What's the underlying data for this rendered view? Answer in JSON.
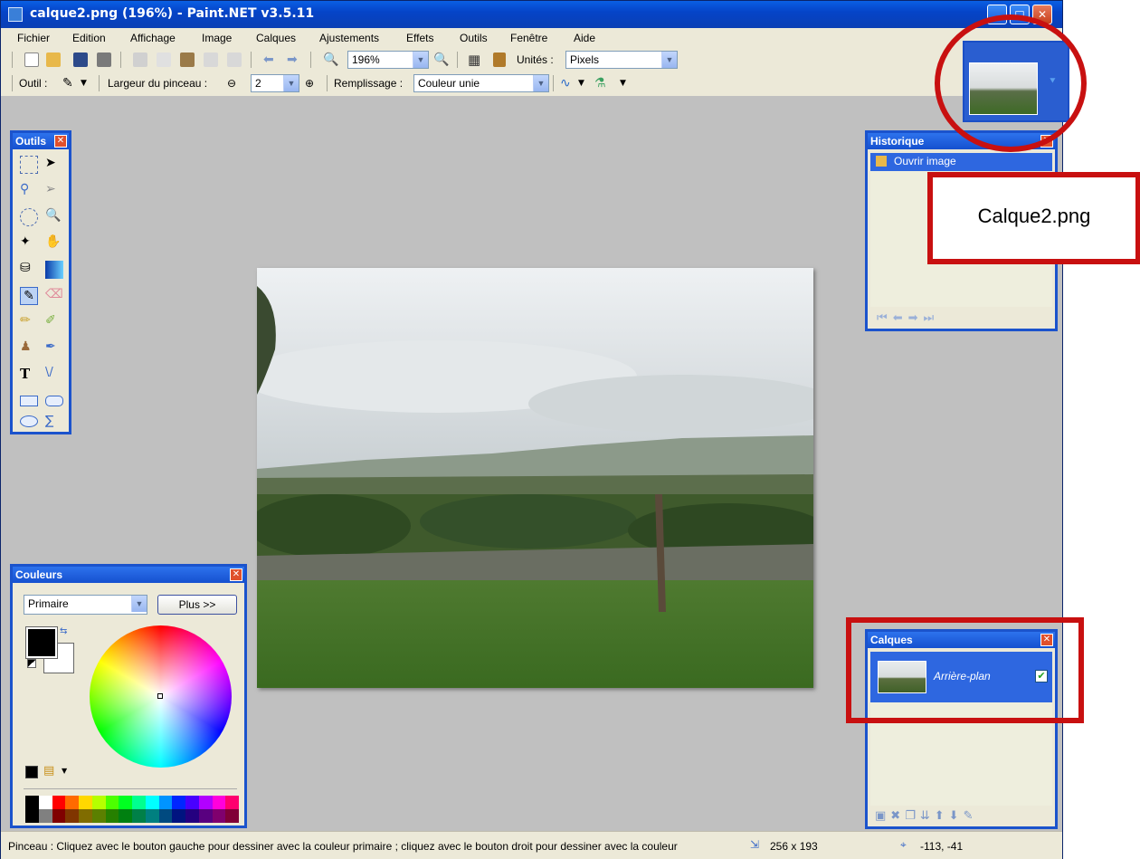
{
  "window": {
    "title": "calque2.png (196%) - Paint.NET v3.5.11"
  },
  "menu": [
    "Fichier",
    "Edition",
    "Affichage",
    "Image",
    "Calques",
    "Ajustements",
    "Effets",
    "Outils",
    "Fenêtre",
    "Aide"
  ],
  "toolbar1": {
    "zoom_value": "196%",
    "units_label": "Unités :",
    "units_value": "Pixels"
  },
  "toolbar2": {
    "tool_label": "Outil :",
    "brush_width_label": "Largeur du pinceau :",
    "brush_width_value": "2",
    "fill_label": "Remplissage :",
    "fill_value": "Couleur unie"
  },
  "palettes": {
    "tools_title": "Outils",
    "history_title": "Historique",
    "history_items": [
      "Ouvrir image"
    ],
    "layers_title": "Calques",
    "layers": [
      {
        "name": "Arrière-plan",
        "visible": true
      }
    ],
    "colors_title": "Couleurs",
    "colors_mode": "Primaire",
    "colors_more_button": "Plus >>",
    "primary_color": "#000000",
    "secondary_color": "#ffffff"
  },
  "palette_swatches": [
    "#000000",
    "#ffffff",
    "#ff0000",
    "#ff6a00",
    "#ffd800",
    "#b6ff00",
    "#4cff00",
    "#00ff21",
    "#00ff90",
    "#00ffff",
    "#0094ff",
    "#0026ff",
    "#4800ff",
    "#b200ff",
    "#ff00dc",
    "#ff006e"
  ],
  "status": {
    "message": "Pinceau : Cliquez avec le bouton gauche pour dessiner avec la couleur primaire ; cliquez avec le bouton droit pour dessiner avec la couleur",
    "image_size": "256 x 193",
    "cursor_position": "-113, -41"
  },
  "annotation": {
    "label": "Calque2.png"
  },
  "colors": {
    "titlebar": "#0a4fd8",
    "annotation_red": "#c81010",
    "workspace": "#c0c0c0"
  }
}
